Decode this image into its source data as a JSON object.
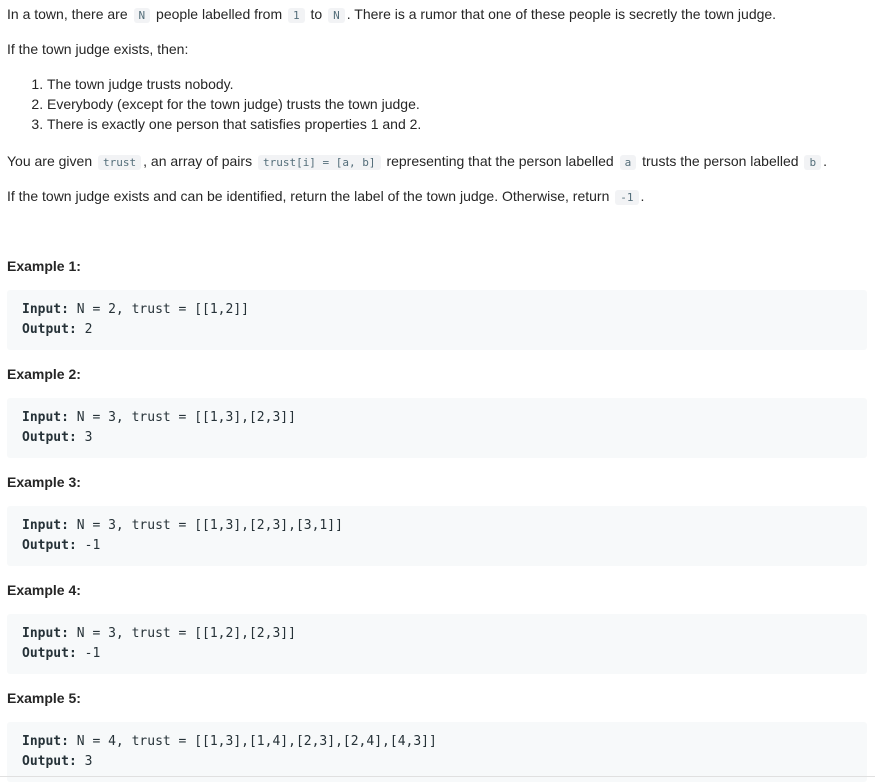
{
  "intro": {
    "p1_a": "In a town, there are",
    "code_N": "N",
    "p1_b": "people labelled from",
    "code_1": "1",
    "p1_c": "to",
    "p1_d": ". There is a rumor that one of these people is secretly the town judge.",
    "p2": "If the town judge exists, then:",
    "rules": [
      "The town judge trusts nobody.",
      "Everybody (except for the town judge) trusts the town judge.",
      "There is exactly one person that satisfies properties 1 and 2."
    ],
    "p3_a": "You are given",
    "code_trust": "trust",
    "p3_b": ", an array of pairs",
    "code_pair": "trust[i] = [a, b]",
    "p3_c": "representing that the person labelled",
    "code_a": "a",
    "p3_d": "trusts the person labelled",
    "code_b": "b",
    "p3_e": ".",
    "p4_a": "If the town judge exists and can be identified, return the label of the town judge.  Otherwise, return",
    "code_neg1": "-1",
    "p4_b": "."
  },
  "labels": {
    "input": "Input:",
    "output": "Output:"
  },
  "examples": [
    {
      "title": "Example 1:",
      "input": "N = 2, trust = [[1,2]]",
      "output": "2"
    },
    {
      "title": "Example 2:",
      "input": "N = 3, trust = [[1,3],[2,3]]",
      "output": "3"
    },
    {
      "title": "Example 3:",
      "input": "N = 3, trust = [[1,3],[2,3],[3,1]]",
      "output": "-1"
    },
    {
      "title": "Example 4:",
      "input": "N = 3, trust = [[1,2],[2,3]]",
      "output": "-1"
    },
    {
      "title": "Example 5:",
      "input": "N = 4, trust = [[1,3],[1,4],[2,3],[2,4],[4,3]]",
      "output": "3"
    }
  ]
}
